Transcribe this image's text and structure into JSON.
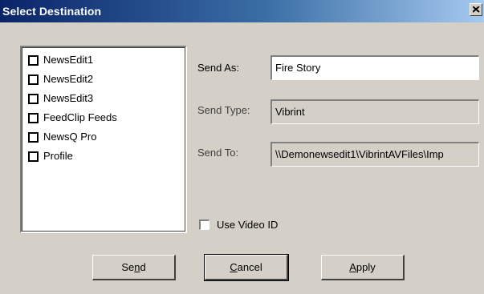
{
  "window": {
    "title": "Select Destination"
  },
  "destinations": [
    {
      "label": "NewsEdit1",
      "checked": false
    },
    {
      "label": "NewsEdit2",
      "checked": false
    },
    {
      "label": "NewsEdit3",
      "checked": false
    },
    {
      "label": "FeedClip Feeds",
      "checked": false
    },
    {
      "label": "NewsQ Pro",
      "checked": false
    },
    {
      "label": "Profile",
      "checked": false
    }
  ],
  "send_as": {
    "label": "Send As:",
    "value": "Fire Story"
  },
  "send_type": {
    "label": "Send Type:",
    "value": "Vibrint"
  },
  "send_to": {
    "label": "Send To:",
    "value": "\\\\Demonewsedit1\\VibrintAVFiles\\Imp"
  },
  "use_video_id": {
    "label": "Use Video ID",
    "checked": false
  },
  "buttons": {
    "send": {
      "pre": "Se",
      "mnemonic": "n",
      "post": "d"
    },
    "cancel": {
      "pre": "",
      "mnemonic": "C",
      "post": "ancel"
    },
    "apply": {
      "pre": "",
      "mnemonic": "A",
      "post": "pply"
    }
  }
}
